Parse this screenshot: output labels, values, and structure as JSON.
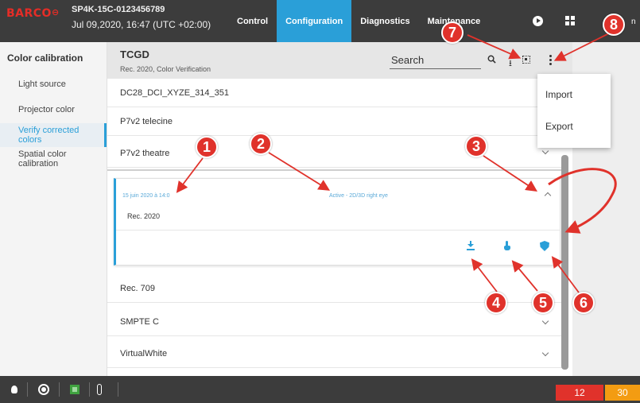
{
  "topbar": {
    "brand": "BARCO",
    "device_id": "SP4K-15C-0123456789",
    "datetime": "Jul 09,2020, 16:47 (UTC +02:00)",
    "tabs": [
      {
        "label": "Control",
        "active": false
      },
      {
        "label": "Configuration",
        "active": true
      },
      {
        "label": "Diagnostics",
        "active": false
      },
      {
        "label": "Maintenance",
        "active": false
      }
    ],
    "user_initial": "n"
  },
  "sidebar": {
    "title": "Color calibration",
    "items": [
      {
        "label": "Light source",
        "active": false
      },
      {
        "label": "Projector color",
        "active": false
      },
      {
        "label": "Verify corrected colors",
        "active": true
      },
      {
        "label": "Spatial color calibration",
        "active": false
      }
    ]
  },
  "list_header": {
    "title": "TCGD",
    "subtitle": "Rec. 2020, Color Verification",
    "search_placeholder": "Search"
  },
  "rows": [
    {
      "label": "DC28_DCI_XYZE_314_351"
    },
    {
      "label": "P7v2 telecine"
    },
    {
      "label": "P7v2 theatre"
    }
  ],
  "expanded": {
    "date": "15 juin 2020 à 14:0",
    "status": "Active - 2D/3D right eye",
    "name": "Rec. 2020"
  },
  "rows_after": [
    {
      "label": "Rec. 709"
    },
    {
      "label": "SMPTE C"
    },
    {
      "label": "VirtualWhite"
    }
  ],
  "menu": {
    "items": [
      "Import",
      "Export"
    ]
  },
  "bottombar": {
    "error_count": "12",
    "warning_count": "30"
  },
  "callouts": [
    "1",
    "2",
    "3",
    "4",
    "5",
    "6",
    "7",
    "8"
  ],
  "colors": {
    "accent": "#2a9fd8",
    "topbar": "#3c3c3c",
    "callout": "#e0322b",
    "error": "#e0322b",
    "warning": "#f39c12"
  }
}
